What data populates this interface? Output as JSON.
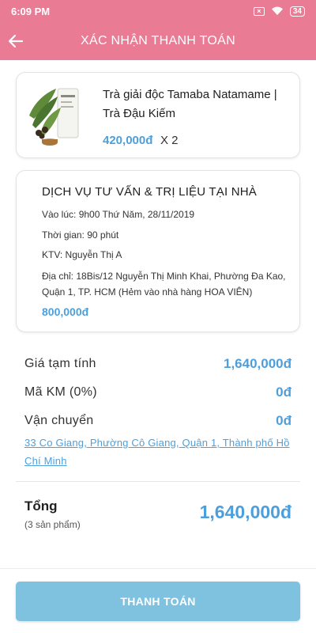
{
  "status_bar": {
    "time": "6:09 PM",
    "battery": "34"
  },
  "header": {
    "title": "XÁC NHẬN THANH TOÁN",
    "back_icon": "arrow-left-icon"
  },
  "product": {
    "name": "Trà giải độc Tamaba Natamame | Trà Đậu Kiếm",
    "price": "420,000đ",
    "quantity": "X 2"
  },
  "service": {
    "title": "DỊCH VỤ TƯ VẤN & TRỊ LIỆU TẠI NHÀ",
    "time_line": "Vào lúc: 9h00 Thứ Năm, 28/11/2019",
    "duration_line": "Thời gian: 90 phút",
    "ktv_line": "KTV: Nguyễn Thị A",
    "address_line": "Địa chỉ: 18Bis/12 Nguyễn Thị Minh Khai, Phường Đa Kao, Quận 1, TP. HCM (Hẻm vào nhà hàng HOA VIÊN)",
    "price": "800,000đ"
  },
  "summary": {
    "subtotal_label": "Giá tạm tính",
    "subtotal_value": "1,640,000đ",
    "promo_label": "Mã KM (0%)",
    "promo_value": "0đ",
    "shipping_label": "Vận chuyển",
    "shipping_value": "0đ",
    "shipping_address": "33 Co Giang, Phường Cô Giang, Quận 1, Thành phố Hồ Chí Minh"
  },
  "total": {
    "label": "Tổng",
    "count": "(3 sản phẩm)",
    "value": "1,640,000đ"
  },
  "actions": {
    "pay_label": "THANH TOÁN"
  },
  "colors": {
    "header": "#e97b95",
    "accent": "#4d9fdc",
    "button": "#7fc2e0"
  }
}
